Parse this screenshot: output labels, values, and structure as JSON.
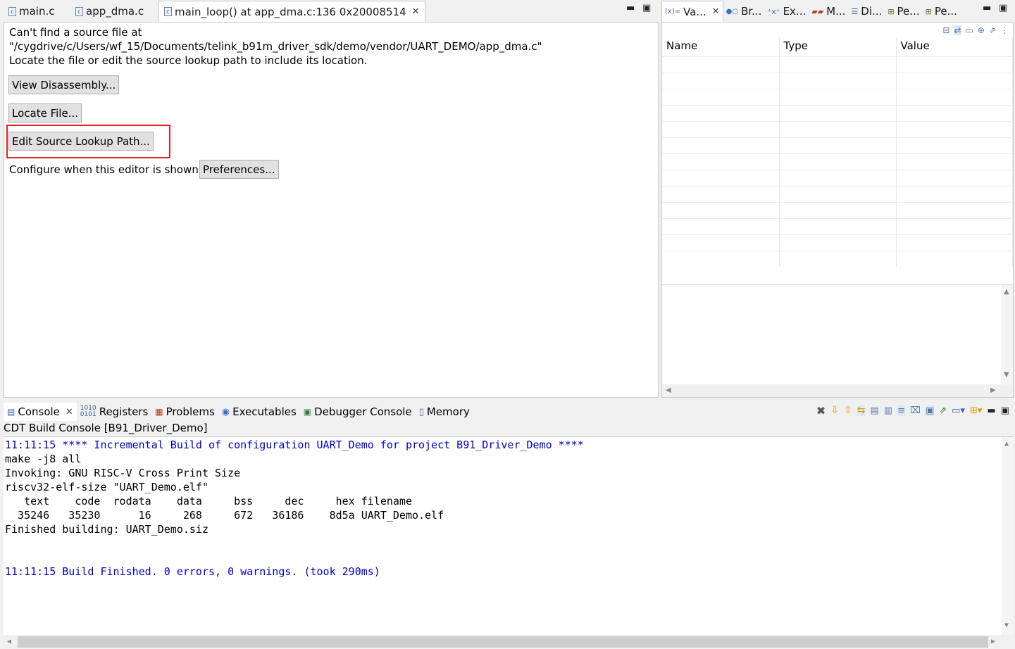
{
  "editor_tabs": [
    {
      "label": "main.c",
      "icon": "c-file-icon"
    },
    {
      "label": "app_dma.c",
      "icon": "c-file-icon"
    },
    {
      "label": "main_loop() at app_dma.c:136 0x20008514",
      "icon": "c-file-icon",
      "active": true
    }
  ],
  "editor": {
    "msg_line1": "Can't find a source file at",
    "msg_line2": "\"/cygdrive/c/Users/wf_15/Documents/telink_b91m_driver_sdk/demo/vendor/UART_DEMO/app_dma.c\"",
    "msg_line3": "Locate the file or edit the source lookup path to include its location.",
    "view_disassembly": "View Disassembly...",
    "locate_file": "Locate File...",
    "edit_source_lookup": "Edit Source Lookup Path...",
    "configure_label": "Configure when this editor is shown",
    "preferences": "Preferences..."
  },
  "right_tabs": [
    {
      "label": "Va...",
      "icon": "variables-icon"
    },
    {
      "label": "Br...",
      "icon": "breakpoints-icon"
    },
    {
      "label": "Ex...",
      "icon": "expressions-icon"
    },
    {
      "label": "M...",
      "icon": "modules-icon"
    },
    {
      "label": "Di...",
      "icon": "disassembly-icon"
    },
    {
      "label": "Pe...",
      "icon": "peripherals-icon"
    },
    {
      "label": "Pe...",
      "icon": "peripherals-icon"
    }
  ],
  "variables_table": {
    "columns": [
      "Name",
      "Type",
      "Value"
    ]
  },
  "console_tabs": [
    {
      "label": "Console",
      "icon": "console-icon",
      "active": true
    },
    {
      "label": "Registers",
      "icon": "registers-icon"
    },
    {
      "label": "Problems",
      "icon": "problems-icon"
    },
    {
      "label": "Executables",
      "icon": "executables-icon"
    },
    {
      "label": "Debugger Console",
      "icon": "debugger-console-icon"
    },
    {
      "label": "Memory",
      "icon": "memory-icon"
    }
  ],
  "console": {
    "title": "CDT Build Console [B91_Driver_Demo]",
    "lines": [
      {
        "text": "11:11:15 **** Incremental Build of configuration UART_Demo for project B91_Driver_Demo ****",
        "color": "blue"
      },
      {
        "text": "make -j8 all",
        "color": "black"
      },
      {
        "text": "Invoking: GNU RISC-V Cross Print Size",
        "color": "black"
      },
      {
        "text": "riscv32-elf-size \"UART_Demo.elf\"",
        "color": "black"
      },
      {
        "text": "   text    code  rodata    data     bss     dec     hex filename",
        "color": "black"
      },
      {
        "text": "  35246   35230      16     268     672   36186    8d5a UART_Demo.elf",
        "color": "black"
      },
      {
        "text": "Finished building: UART_Demo.siz",
        "color": "black"
      },
      {
        "text": "",
        "color": "black"
      },
      {
        "text": "",
        "color": "black"
      },
      {
        "text": "11:11:15 Build Finished. 0 errors, 0 warnings. (took 290ms)",
        "color": "blue"
      }
    ]
  },
  "colors": {
    "console_blue": "#0000c8",
    "highlight_red": "#d9262b"
  }
}
